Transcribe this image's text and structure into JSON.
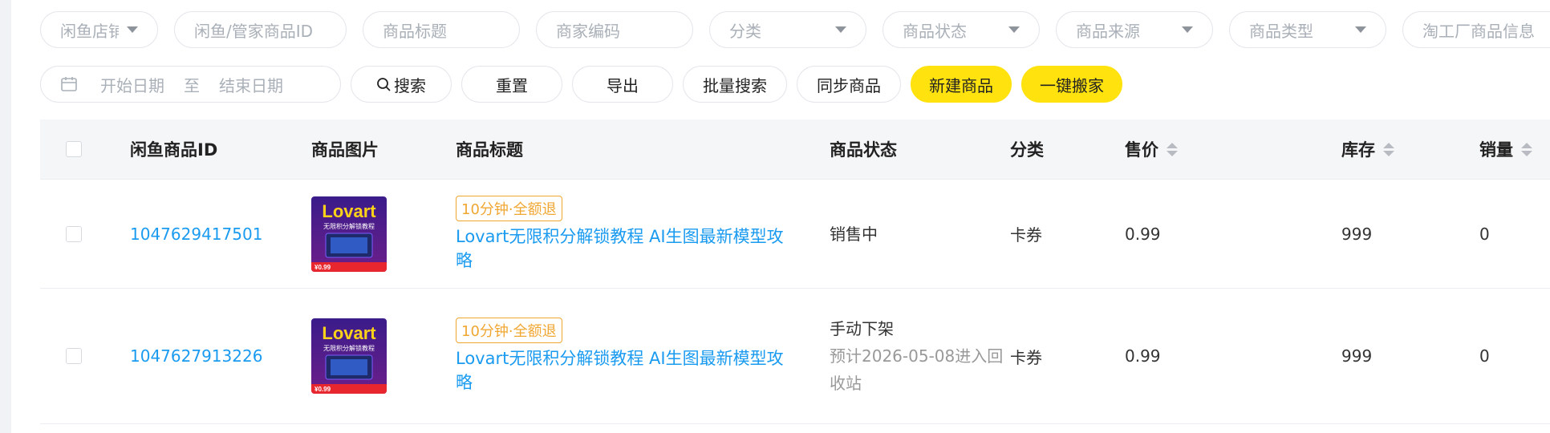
{
  "filters": {
    "shop": "闲鱼店铺",
    "item_id": "闲鱼/管家商品ID",
    "title": "商品标题",
    "merchant_code": "商家编码",
    "category": "分类",
    "status": "商品状态",
    "source": "商品来源",
    "type": "商品类型",
    "taogongchang": "淘工厂商品信息",
    "start_date": "开始日期",
    "date_sep": "至",
    "end_date": "结束日期"
  },
  "actions": {
    "search": "搜索",
    "reset": "重置",
    "export": "导出",
    "batch_search": "批量搜索",
    "sync": "同步商品",
    "new": "新建商品",
    "move": "一键搬家"
  },
  "table": {
    "headers": {
      "id": "闲鱼商品ID",
      "image": "商品图片",
      "title": "商品标题",
      "status": "商品状态",
      "category": "分类",
      "price": "售价",
      "stock": "库存",
      "sales": "销量"
    },
    "rows": [
      {
        "id": "1047629417501",
        "tag": "10分钟·全额退",
        "title": "Lovart无限积分解锁教程 AI生图最新模型攻略",
        "status": "销售中",
        "status_sub": "",
        "category": "卡券",
        "price": "0.99",
        "stock": "999",
        "sales": "0"
      },
      {
        "id": "1047627913226",
        "tag": "10分钟·全额退",
        "title": "Lovart无限积分解锁教程 AI生图最新模型攻略",
        "status": "手动下架",
        "status_sub": "预计2026-05-08进入回收站",
        "category": "卡券",
        "price": "0.99",
        "stock": "999",
        "sales": "0"
      }
    ]
  },
  "thumbnail": {
    "brand": "Lovart",
    "subtitle": "无限积分解锁教程",
    "price": "¥0.99"
  },
  "colors": {
    "accent_yellow": "#ffe20e",
    "link_blue": "#1a9bf0",
    "tag_orange": "#f0a732"
  }
}
